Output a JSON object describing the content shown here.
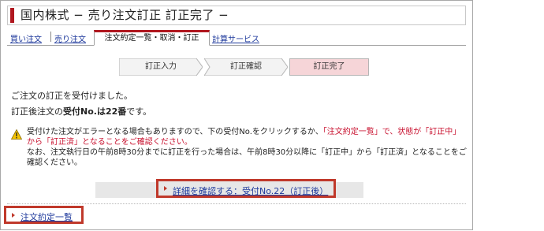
{
  "page": {
    "title": "国内株式 − 売り注文訂正 訂正完了 −"
  },
  "tabs": {
    "buy_order": "買い注文",
    "sell_order": "売り注文",
    "order_list": "注文約定一覧・取消・訂正",
    "calc_service": "計算サービス"
  },
  "steps": [
    "訂正入力",
    "訂正確認",
    "訂正完了"
  ],
  "messages": {
    "line1": "ご注文の訂正を受付けました。",
    "line2_prefix": "訂正後注文の",
    "line2_bold": "受付No.は22番",
    "line2_suffix": "です。"
  },
  "warning": {
    "part1": "受付けた注文がエラーとなる場合もありますので、下の受付No.をクリックするか、",
    "part2_red": "「注文約定一覧」で、状態が「訂正中」から「訂正済」となることをご確認ください。",
    "part3": "なお、注文執行日の午前8時30分までに訂正を行った場合は、午前8時30分以降に「訂正中」から「訂正済」となることをご確認ください。"
  },
  "links": {
    "confirm_detail": "詳細を確認する：受付No.22（訂正後）",
    "order_list": "注文約定一覧"
  },
  "colors": {
    "brand_red": "#b0171f",
    "highlight_red": "#c0392b",
    "link_blue": "#1f3a9c",
    "step_active": "#f6d5d8"
  }
}
